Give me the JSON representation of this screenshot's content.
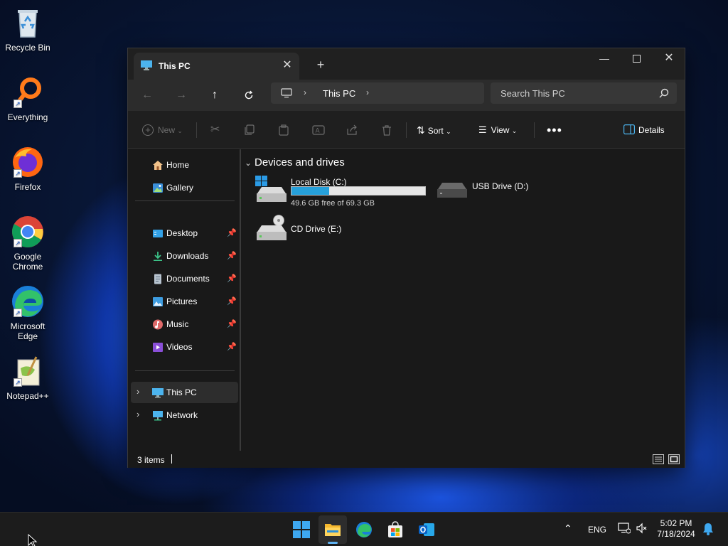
{
  "desktop": {
    "icons": [
      {
        "label": "Recycle Bin",
        "icon": "recycle-bin-icon"
      },
      {
        "label": "Everything",
        "icon": "everything-search-icon"
      },
      {
        "label": "Firefox",
        "icon": "firefox-icon"
      },
      {
        "label": "Google Chrome",
        "icon": "chrome-icon"
      },
      {
        "label": "Microsoft Edge",
        "icon": "edge-icon"
      },
      {
        "label": "Notepad++",
        "icon": "notepadpp-icon"
      }
    ]
  },
  "window": {
    "tab_title": "This PC",
    "breadcrumb": [
      "This PC"
    ],
    "search_placeholder": "Search This PC",
    "toolbar": {
      "new_label": "New",
      "sort_label": "Sort",
      "view_label": "View",
      "details_label": "Details"
    },
    "sidebar": {
      "quick": [
        {
          "label": "Home",
          "icon": "home-icon"
        },
        {
          "label": "Gallery",
          "icon": "gallery-icon"
        }
      ],
      "pinned": [
        {
          "label": "Desktop",
          "icon": "desktop-folder-icon"
        },
        {
          "label": "Downloads",
          "icon": "downloads-icon"
        },
        {
          "label": "Documents",
          "icon": "documents-icon"
        },
        {
          "label": "Pictures",
          "icon": "pictures-icon"
        },
        {
          "label": "Music",
          "icon": "music-icon"
        },
        {
          "label": "Videos",
          "icon": "videos-icon"
        }
      ],
      "locations": [
        {
          "label": "This PC",
          "icon": "this-pc-icon",
          "selected": true
        },
        {
          "label": "Network",
          "icon": "network-icon",
          "selected": false
        }
      ]
    },
    "group_title": "Devices and drives",
    "drives": [
      {
        "name": "Local Disk (C:)",
        "free_text": "49.6 GB free of 69.3 GB",
        "used_fraction": 0.284
      },
      {
        "name": "USB Drive (D:)"
      },
      {
        "name": "CD Drive (E:)"
      }
    ],
    "status": {
      "items_text": "3 items"
    },
    "colors": {
      "accent": "#26a0da",
      "window_bg": "#191919",
      "navbar_bg": "#2c2c2c"
    }
  },
  "taskbar": {
    "language": "ENG",
    "time": "5:02 PM",
    "date": "7/18/2024"
  }
}
